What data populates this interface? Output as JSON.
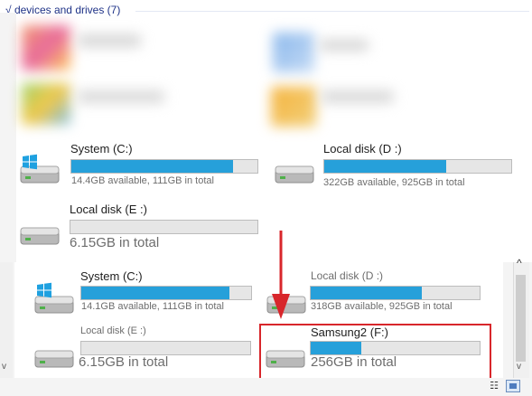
{
  "section": {
    "header": "devices and drives (7)",
    "chevron": "√"
  },
  "icons": {
    "drive": "hard-drive-icon",
    "windows": "windows-logo-icon",
    "chevron": "chevron-check-icon"
  },
  "colors": {
    "bar_fill": "#26a0da",
    "highlight": "#d8262b",
    "header_text": "#1e3287"
  },
  "top_drives": [
    {
      "name": "System (C:)",
      "info": "14.4GB available, 111GB in total",
      "usage_fraction": 0.87,
      "windows": true
    },
    {
      "name": "Local disk (D :)",
      "info": "322GB available, 925GB in total",
      "usage_fraction": 0.65,
      "windows": false
    },
    {
      "name": "Local disk (E :)",
      "info": "6.15GB in total",
      "usage_fraction": 0.0,
      "windows": false
    }
  ],
  "bottom_drives": [
    {
      "name": "System (C:)",
      "info": "14.1GB available, 111GB in total",
      "usage_fraction": 0.87,
      "windows": true
    },
    {
      "name": "Local disk (D :)",
      "info": "318GB available, 925GB in total",
      "usage_fraction": 0.66,
      "windows": false
    },
    {
      "name": "Local disk (E :)",
      "info": "6.15GB in total",
      "usage_fraction": 0.0,
      "windows": false
    },
    {
      "name": "Samsung2 (F:)",
      "info": "256GB in total",
      "usage_fraction": 0.3,
      "windows": false
    }
  ],
  "scrollbar": {
    "up": "^",
    "down": "v"
  },
  "view_buttons": {
    "details": "☷"
  }
}
